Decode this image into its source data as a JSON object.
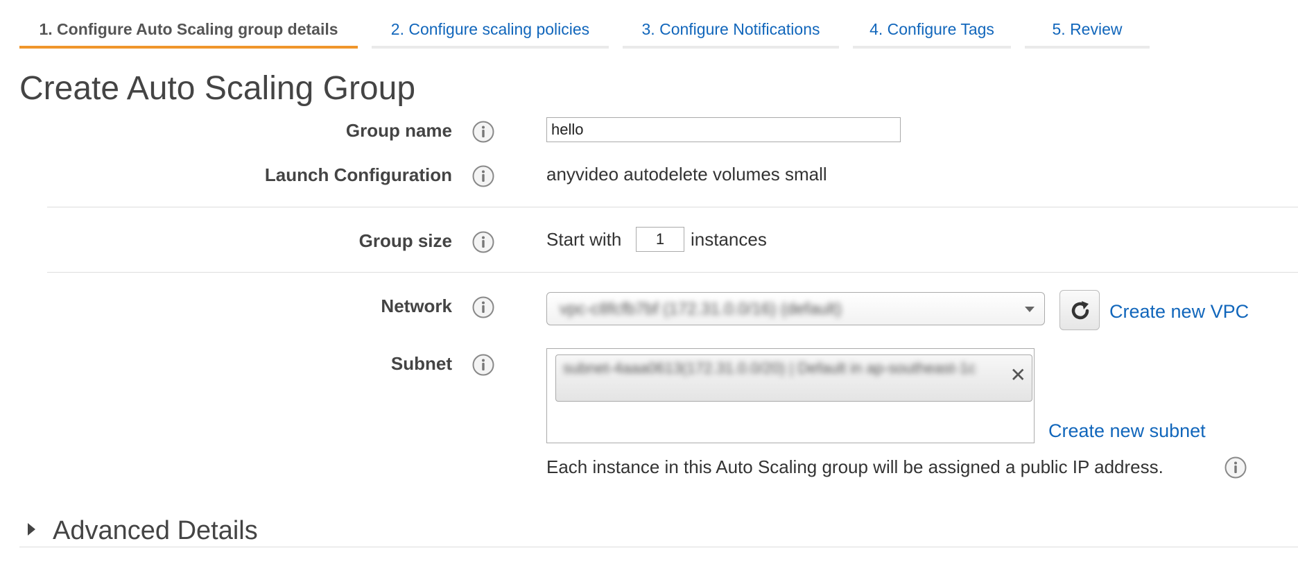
{
  "tabs": [
    {
      "label": "1. Configure Auto Scaling group details",
      "active": true
    },
    {
      "label": "2. Configure scaling policies",
      "active": false
    },
    {
      "label": "3. Configure Notifications",
      "active": false
    },
    {
      "label": "4. Configure Tags",
      "active": false
    },
    {
      "label": "5. Review",
      "active": false
    }
  ],
  "page_title": "Create Auto Scaling Group",
  "form": {
    "group_name": {
      "label": "Group name",
      "value": "hello"
    },
    "launch_configuration": {
      "label": "Launch Configuration",
      "value": "anyvideo autodelete volumes small"
    },
    "group_size": {
      "label": "Group size",
      "prefix": "Start with",
      "value": "1",
      "suffix": "instances"
    },
    "network": {
      "label": "Network",
      "selected": "vpc-c8fcfb7bf (172.31.0.0/16) (default)",
      "create_link": "Create new VPC"
    },
    "subnet": {
      "label": "Subnet",
      "chip": "subnet-4aaa0613(172.31.0.0/20) | Default in ap-southeast-1c",
      "create_link": "Create new subnet",
      "note": "Each instance in this Auto Scaling group will be assigned a public IP address."
    }
  },
  "advanced": {
    "title": "Advanced Details",
    "expanded": false
  },
  "colors": {
    "accent_tab": "#f0962b",
    "link": "#1166bb"
  },
  "icons": {
    "info": "info-icon",
    "refresh": "refresh-icon",
    "dropdown": "chevron-down-icon",
    "close": "close-icon",
    "expand": "caret-right-icon"
  }
}
